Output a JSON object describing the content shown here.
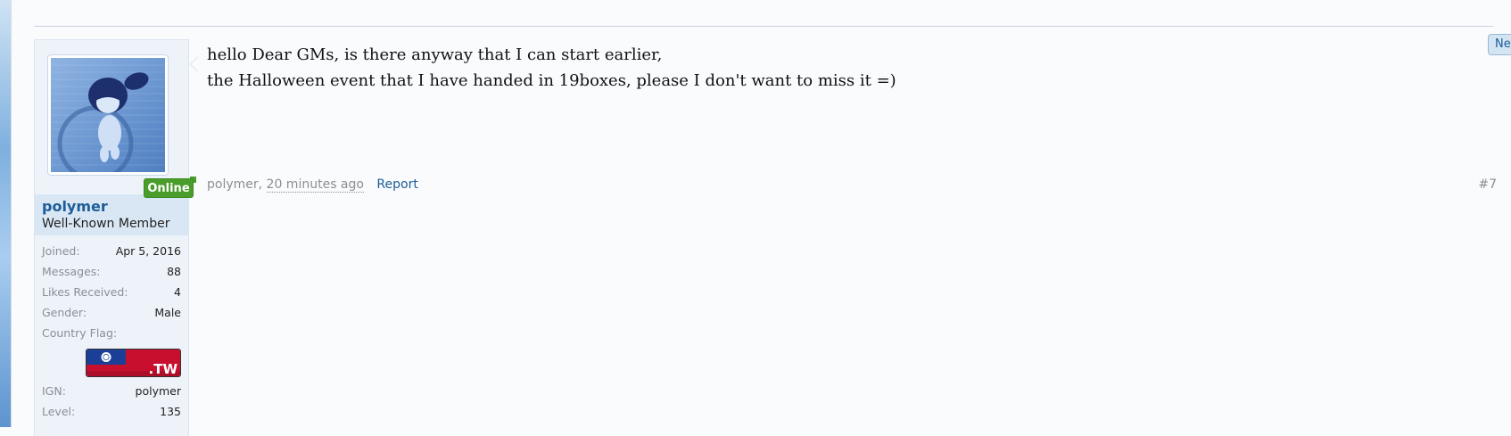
{
  "user": {
    "name": "polymer",
    "title": "Well-Known Member",
    "status": "Online",
    "flag_text": ".TW",
    "avatar": "anime-character-avatar",
    "info": [
      {
        "label": "Joined:",
        "value": "Apr 5, 2016"
      },
      {
        "label": "Messages:",
        "value": "88"
      },
      {
        "label": "Likes Received:",
        "value": "4"
      },
      {
        "label": "Gender:",
        "value": "Male"
      },
      {
        "label": "Country Flag:",
        "value": ""
      },
      {
        "label": "IGN:",
        "value": "polymer"
      },
      {
        "label": "Level:",
        "value": "135"
      }
    ]
  },
  "post": {
    "lines": [
      "hello Dear GMs, is there anyway that I can start earlier,",
      "the Halloween event that I have handed in 19boxes, please I don't want to miss it =)"
    ],
    "author": "polymer",
    "time": "20 minutes ago",
    "report_label": "Report",
    "number": "#7",
    "new_label": "New"
  },
  "colors": {
    "accent": "#1d5c98",
    "online": "#4a9d2b",
    "panel": "#eef3fa",
    "name_block": "#d9e7f5"
  }
}
